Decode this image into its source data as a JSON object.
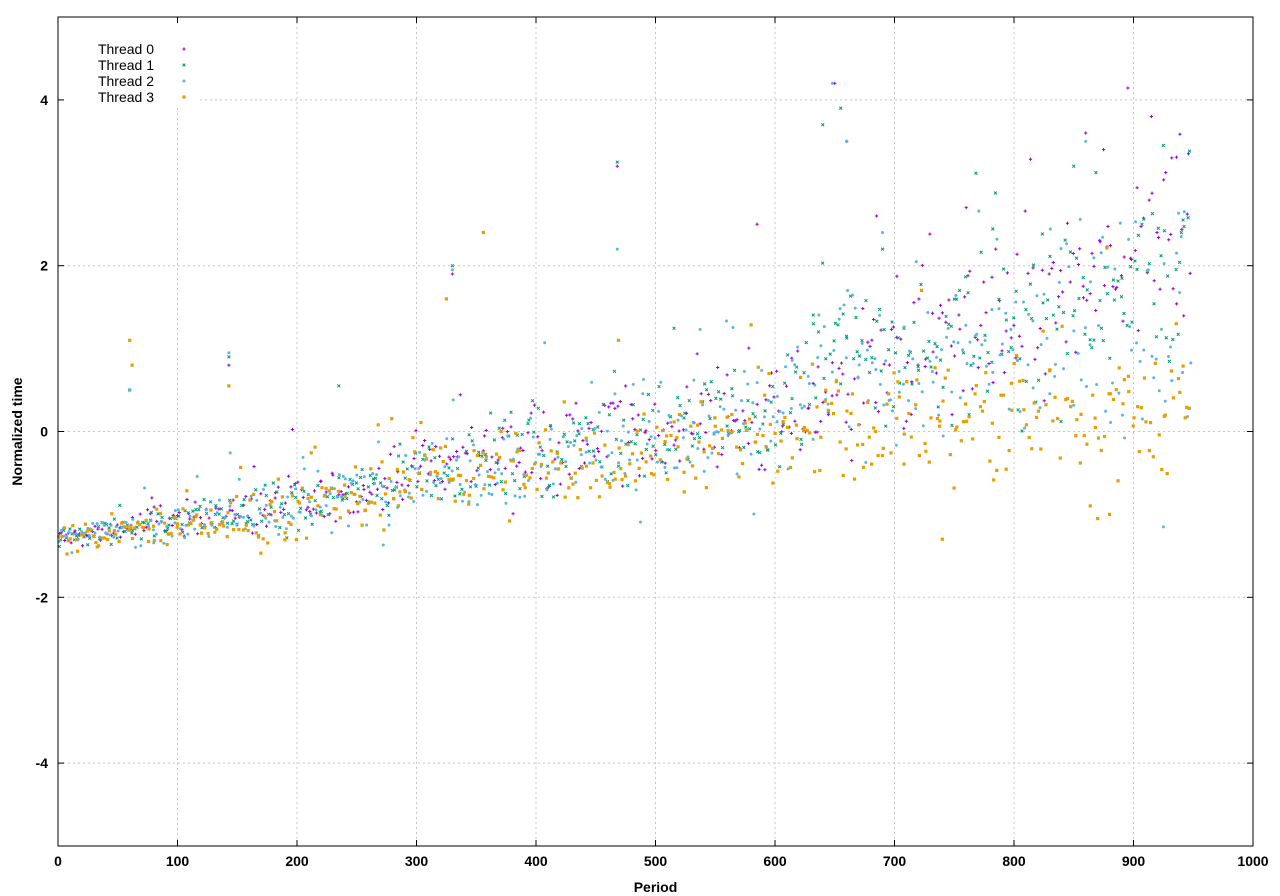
{
  "chart_data": {
    "type": "scatter",
    "title": "",
    "xlabel": "Period",
    "ylabel": "Normalized time",
    "xlim": [
      0,
      1000
    ],
    "ylim": [
      -5,
      5
    ],
    "x_ticks": [
      0,
      100,
      200,
      300,
      400,
      500,
      600,
      700,
      800,
      900,
      1000
    ],
    "y_ticks": [
      -4,
      -2,
      0,
      2,
      4
    ],
    "grid": true,
    "legend_position": "top-left",
    "x_max_period": 946,
    "series": [
      {
        "name": "Thread 0",
        "color": "#9400d3",
        "marker": "plus",
        "trend": [
          [
            0,
            -1.3
          ],
          [
            100,
            -1.05
          ],
          [
            200,
            -0.9
          ],
          [
            280,
            -0.6
          ],
          [
            300,
            -0.4
          ],
          [
            400,
            -0.2
          ],
          [
            500,
            0.0
          ],
          [
            600,
            0.15
          ],
          [
            700,
            0.9
          ],
          [
            800,
            1.3
          ],
          [
            946,
            2.3
          ]
        ],
        "spread": [
          [
            0,
            0.1
          ],
          [
            300,
            0.3
          ],
          [
            600,
            0.55
          ],
          [
            946,
            0.9
          ]
        ],
        "highlights": [
          [
            60,
            0.5
          ],
          [
            143,
            0.8
          ],
          [
            330,
            1.9
          ],
          [
            468,
            3.2
          ],
          [
            585,
            2.5
          ],
          [
            650,
            4.2
          ],
          [
            660,
            3.5
          ],
          [
            685,
            2.6
          ],
          [
            760,
            2.7
          ],
          [
            860,
            3.6
          ],
          [
            875,
            3.4
          ],
          [
            915,
            3.8
          ],
          [
            932,
            3.3
          ],
          [
            946,
            3.35
          ]
        ]
      },
      {
        "name": "Thread 1",
        "color": "#009e73",
        "marker": "cross",
        "trend": [
          [
            0,
            -1.3
          ],
          [
            100,
            -1.05
          ],
          [
            200,
            -0.9
          ],
          [
            280,
            -0.6
          ],
          [
            300,
            -0.45
          ],
          [
            400,
            -0.25
          ],
          [
            500,
            0.0
          ],
          [
            600,
            0.15
          ],
          [
            650,
            1.0
          ],
          [
            700,
            0.9
          ],
          [
            800,
            1.3
          ],
          [
            946,
            2.2
          ]
        ],
        "spread": [
          [
            0,
            0.1
          ],
          [
            300,
            0.3
          ],
          [
            600,
            0.55
          ],
          [
            946,
            0.9
          ]
        ],
        "highlights": [
          [
            60,
            0.5
          ],
          [
            143,
            0.9
          ],
          [
            235,
            0.55
          ],
          [
            330,
            2.0
          ],
          [
            468,
            3.25
          ],
          [
            640,
            3.7
          ],
          [
            655,
            3.9
          ],
          [
            690,
            2.2
          ],
          [
            850,
            3.2
          ],
          [
            925,
            3.45
          ],
          [
            940,
            2.4
          ]
        ]
      },
      {
        "name": "Thread 2",
        "color": "#56b4e9",
        "marker": "star",
        "trend": [
          [
            0,
            -1.3
          ],
          [
            100,
            -1.1
          ],
          [
            200,
            -0.95
          ],
          [
            280,
            -0.65
          ],
          [
            300,
            -0.5
          ],
          [
            400,
            -0.3
          ],
          [
            500,
            -0.05
          ],
          [
            600,
            0.1
          ],
          [
            650,
            0.8
          ],
          [
            700,
            0.7
          ],
          [
            800,
            1.0
          ],
          [
            946,
            1.6
          ]
        ],
        "spread": [
          [
            0,
            0.1
          ],
          [
            300,
            0.35
          ],
          [
            600,
            0.6
          ],
          [
            946,
            1.0
          ]
        ],
        "highlights": [
          [
            60,
            0.5
          ],
          [
            143,
            0.95
          ],
          [
            330,
            1.95
          ],
          [
            468,
            2.2
          ],
          [
            648,
            4.2
          ],
          [
            660,
            3.5
          ],
          [
            690,
            2.4
          ],
          [
            860,
            3.5
          ],
          [
            925,
            -1.15
          ],
          [
            940,
            2.35
          ]
        ]
      },
      {
        "name": "Thread 3",
        "color": "#e69f00",
        "marker": "square",
        "trend": [
          [
            0,
            -1.3
          ],
          [
            100,
            -1.15
          ],
          [
            200,
            -0.95
          ],
          [
            280,
            -0.7
          ],
          [
            300,
            -0.45
          ],
          [
            400,
            -0.5
          ],
          [
            500,
            -0.2
          ],
          [
            600,
            -0.05
          ],
          [
            700,
            0.1
          ],
          [
            800,
            0.2
          ],
          [
            946,
            0.3
          ]
        ],
        "spread": [
          [
            0,
            0.12
          ],
          [
            300,
            0.35
          ],
          [
            600,
            0.45
          ],
          [
            946,
            0.8
          ]
        ],
        "highlights": [
          [
            60,
            1.1
          ],
          [
            62,
            0.8
          ],
          [
            143,
            0.55
          ],
          [
            325,
            1.6
          ],
          [
            356,
            2.4
          ],
          [
            469,
            1.1
          ],
          [
            740,
            -1.3
          ],
          [
            870,
            -1.05
          ],
          [
            880,
            -1.0
          ]
        ]
      }
    ]
  }
}
